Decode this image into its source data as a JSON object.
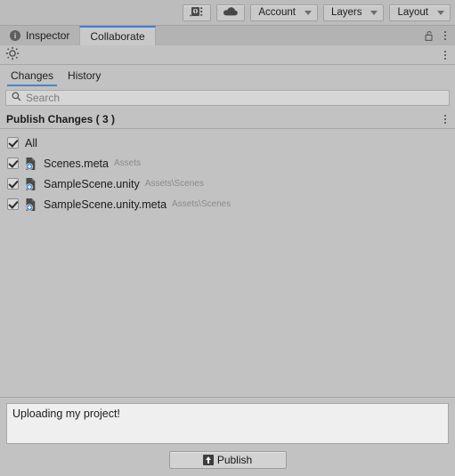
{
  "editor_toolbar": {
    "collab_icon": "collab-services-icon",
    "cloud_icon": "cloud-icon",
    "dropdowns": [
      {
        "label": "Account",
        "name": "account-dropdown"
      },
      {
        "label": "Layers",
        "name": "layers-dropdown"
      },
      {
        "label": "Layout",
        "name": "layout-dropdown"
      }
    ]
  },
  "window_tabs": {
    "items": [
      {
        "label": "Inspector",
        "active": false,
        "icon": "info-icon"
      },
      {
        "label": "Collaborate",
        "active": true,
        "icon": ""
      }
    ],
    "lock_icon": "unlocked-padlock-icon",
    "menu_icon": "kebab-menu-icon"
  },
  "collab_bar": {
    "status_icon": "collab-sync-icon",
    "menu_icon": "kebab-menu-icon"
  },
  "subtabs": {
    "items": [
      {
        "label": "Changes",
        "active": true
      },
      {
        "label": "History",
        "active": false
      }
    ]
  },
  "search": {
    "placeholder": "Search",
    "value": "",
    "icon": "search-icon"
  },
  "publish_changes": {
    "title": "Publish Changes ( 3 )",
    "count": 3,
    "menu_icon": "kebab-menu-icon"
  },
  "file_list": {
    "select_all": {
      "label": "All",
      "checked": true
    },
    "items": [
      {
        "name": "Scenes.meta",
        "path": "Assets",
        "checked": true,
        "icon": "file-added-icon"
      },
      {
        "name": "SampleScene.unity",
        "path": "Assets\\Scenes",
        "checked": true,
        "icon": "file-added-icon"
      },
      {
        "name": "SampleScene.unity.meta",
        "path": "Assets\\Scenes",
        "checked": true,
        "icon": "file-added-icon"
      }
    ]
  },
  "bottom": {
    "comment_value": "Uploading my project!",
    "comment_placeholder": "",
    "publish_label": "Publish",
    "publish_icon": "upload-icon"
  },
  "colors": {
    "panel_bg": "#c2c2c2",
    "toolbar_bg": "#bcbcbc",
    "tab_active_bg": "#c9c9c9",
    "accent_blue": "#4b82c6",
    "tab_top_accent": "#3f7fd4",
    "add_badge_blue": "#2f7fd6",
    "text": "#1b1b1b",
    "muted_text": "#8a8a8a"
  }
}
